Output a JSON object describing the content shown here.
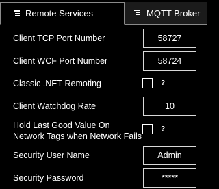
{
  "tabs": [
    {
      "label": "Remote Services",
      "active": true,
      "icon": "list-icon"
    },
    {
      "label": "MQTT Broker",
      "active": false,
      "icon": "list-icon"
    }
  ],
  "settings": {
    "tcp_port": {
      "label": "Client TCP Port Number",
      "value": "58727"
    },
    "wcf_port": {
      "label": "Client WCF Port Number",
      "value": "58724"
    },
    "net_remoting": {
      "label": "Classic .NET Remoting",
      "checked": false,
      "help": "?"
    },
    "watchdog_rate": {
      "label": "Client Watchdog Rate",
      "value": "10"
    },
    "hold_last_good": {
      "label_line1": "Hold Last Good Value On",
      "label_line2": "Network Tags when Network Fails",
      "checked": false,
      "help": "?"
    },
    "security_user": {
      "label": "Security User Name",
      "value": "Admin"
    },
    "security_password": {
      "label": "Security Password",
      "value": "*****"
    }
  },
  "colors": {
    "background": "#000000",
    "text": "#ffffff",
    "field_border": "#d8d8d8",
    "inactive_tab": "#1b1b1b",
    "tab_border": "#8a8a8a"
  }
}
